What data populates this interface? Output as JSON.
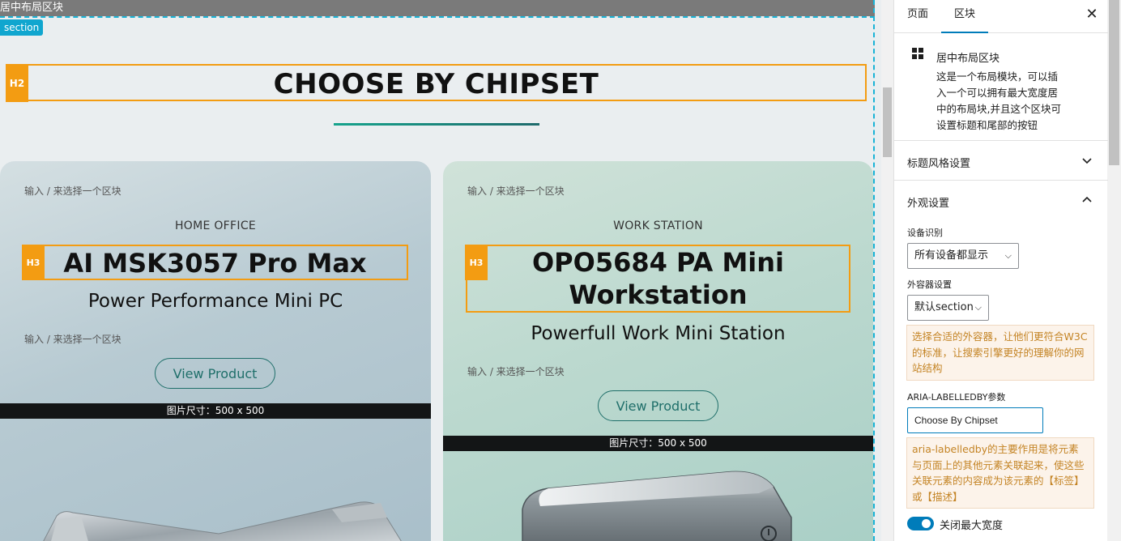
{
  "canvas": {
    "block_label": "居中布局区块",
    "section_badge": "section",
    "heading_tag": "H2",
    "heading": "CHOOSE BY CHIPSET",
    "cards": [
      {
        "hint_top": "输入 / 来选择一个区块",
        "eyebrow": "HOME OFFICE",
        "heading_tag": "H3",
        "title": "AI MSK3057 Pro Max",
        "subtitle": "Power Performance Mini PC",
        "hint_bottom": "输入 / 来选择一个区块",
        "button": "View Product",
        "image_size": "图片尺寸：500 x 500"
      },
      {
        "hint_top": "输入 / 来选择一个区块",
        "eyebrow": "WORK STATION",
        "heading_tag": "H3",
        "title_line1": "OPO5684 PA Mini",
        "title_line2": "Workstation",
        "subtitle": "Powerfull Work Mini Station",
        "hint_bottom": "输入 / 来选择一个区块",
        "button": "View Product",
        "image_size": "图片尺寸：500 x 500"
      }
    ]
  },
  "inspector": {
    "tabs": [
      "页面",
      "区块"
    ],
    "active_tab": "区块",
    "block": {
      "icon": "grid-icon",
      "name": "居中布局区块",
      "description": "这是一个布局模块，可以插入一个可以拥有最大宽度居中的布局块,并且这个区块可设置标题和尾部的按钮"
    },
    "accordion_title_style": "标题风格设置",
    "accordion_appearance": "外观设置",
    "device_label": "设备识别",
    "device_value": "所有设备都显示",
    "container_label": "外容器设置",
    "container_value": "默认section",
    "container_notice": "选择合适的外容器，让他们更符合W3C的标准，让搜索引擎更好的理解你的网站结构",
    "aria_label": "ARIA-LABELLEDBY参数",
    "aria_value": "Choose By Chipset",
    "aria_notice": "aria-labelledby的主要作用是将元素与页面上的其他元素关联起来，使这些关联元素的内容成为该元素的【标签】或【描述】",
    "toggle_label": "关闭最大宽度",
    "toggle_on": true
  },
  "colors": {
    "accent": "#007cba",
    "h_outline": "#f39c12",
    "notice_text": "#c48425",
    "button_teal": "#1f6f6a"
  }
}
